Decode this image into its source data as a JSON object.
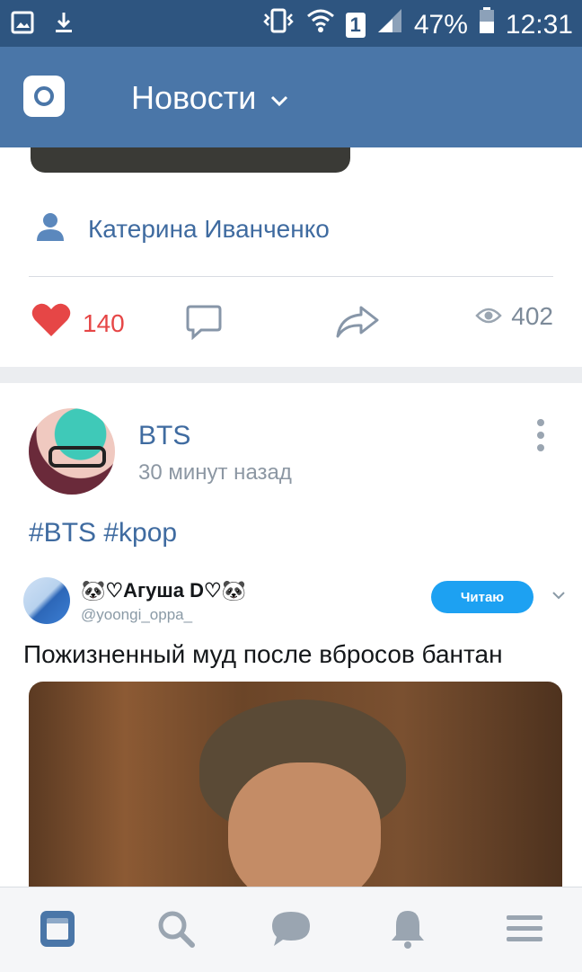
{
  "status_bar": {
    "battery": "47%",
    "time": "12:31",
    "sim": "1",
    "icons": [
      "gallery-icon",
      "download-icon",
      "vibrate-icon",
      "wifi-icon",
      "signal-icon",
      "battery-icon"
    ]
  },
  "app_bar": {
    "title": "Новости",
    "left_icon": "camera-icon",
    "dropdown_icon": "chevron-down-icon",
    "color": "#4a76a8"
  },
  "post1": {
    "author": "Катерина Иванченко",
    "likes": "140",
    "views": "402",
    "like_color": "#e64646"
  },
  "post2": {
    "group_name": "BTS",
    "time": "30 минут назад",
    "hashtags": "#BTS #kpop",
    "embedded_tweet": {
      "name": "🐼♡Агуша D♡🐼",
      "handle": "@yoongi_oppa_",
      "follow_label": "Читаю",
      "text": "Пожизненный муд после вбросов бантан"
    }
  },
  "bottom_nav": {
    "items": [
      "news-icon",
      "search-icon",
      "messages-icon",
      "notifications-icon",
      "menu-icon"
    ],
    "active_color": "#4a76a8",
    "inactive_color": "#9aa5b1"
  }
}
